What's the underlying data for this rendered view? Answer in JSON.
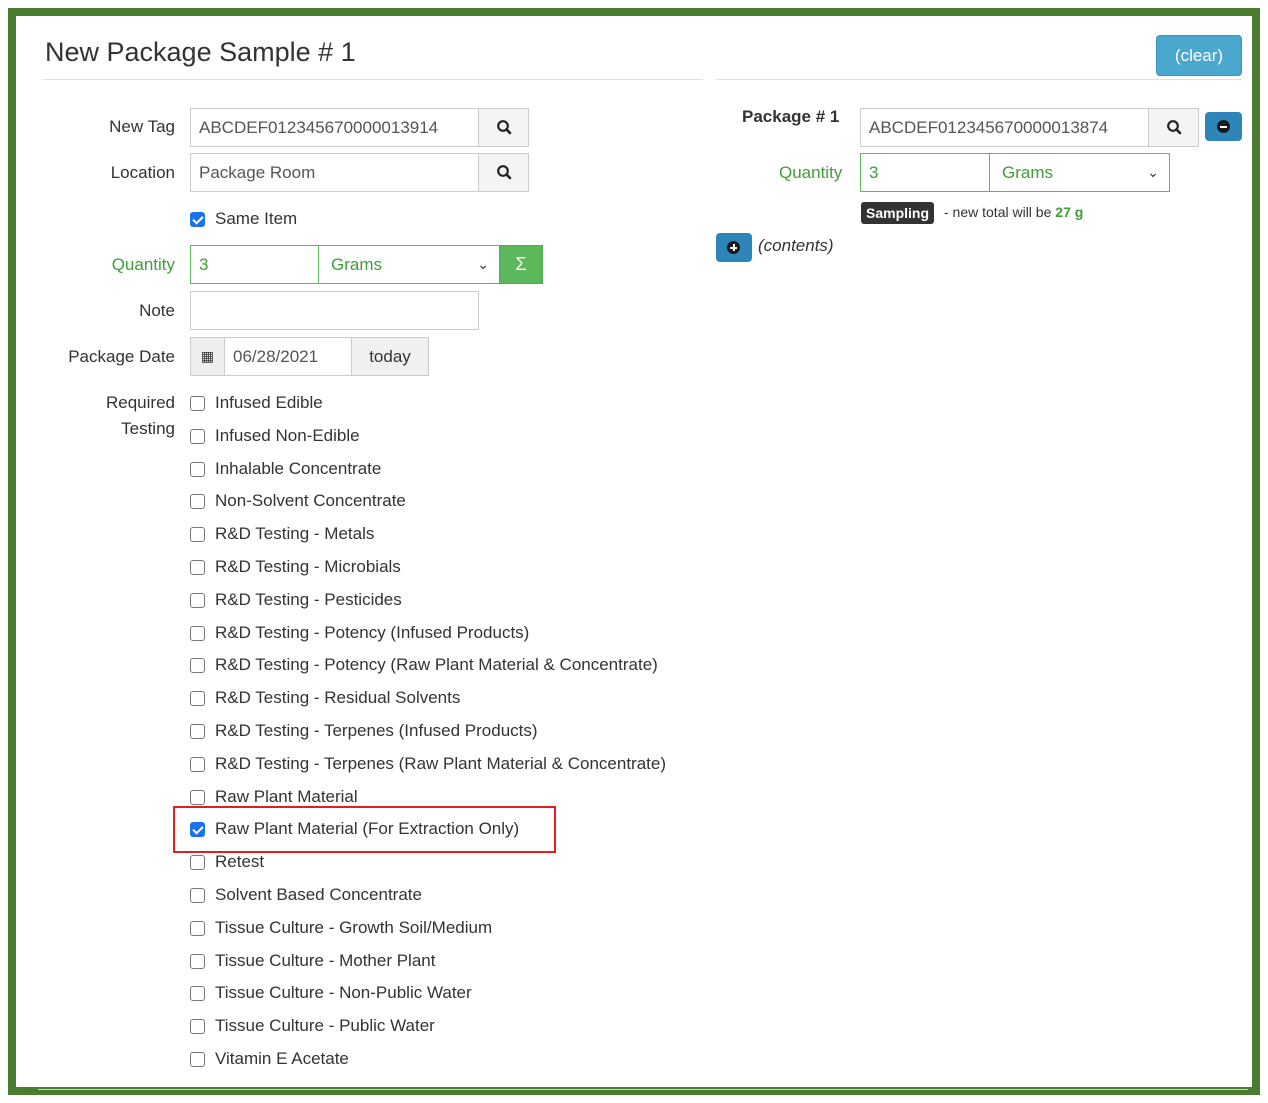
{
  "modal": {
    "title": "New Package Sample # 1",
    "clear_label": "(clear)"
  },
  "left": {
    "new_tag_label": "New Tag",
    "new_tag_value": "ABCDEF012345670000013914",
    "location_label": "Location",
    "location_value": "Package Room",
    "same_item_label": "Same Item",
    "same_item_checked": true,
    "quantity_label": "Quantity",
    "quantity_value": "3",
    "unit_value": "Grams",
    "sigma_label": "Σ",
    "note_label": "Note",
    "note_value": "",
    "package_date_label": "Package Date",
    "package_date_value": "06/28/2021",
    "today_label": "today",
    "required_testing_label_1": "Required",
    "required_testing_label_2": "Testing"
  },
  "tests": [
    {
      "label": "Infused Edible",
      "checked": false
    },
    {
      "label": "Infused Non-Edible",
      "checked": false
    },
    {
      "label": "Inhalable Concentrate",
      "checked": false
    },
    {
      "label": "Non-Solvent Concentrate",
      "checked": false
    },
    {
      "label": "R&D Testing - Metals",
      "checked": false
    },
    {
      "label": "R&D Testing - Microbials",
      "checked": false
    },
    {
      "label": "R&D Testing - Pesticides",
      "checked": false
    },
    {
      "label": "R&D Testing - Potency (Infused Products)",
      "checked": false
    },
    {
      "label": "R&D Testing - Potency (Raw Plant Material & Concentrate)",
      "checked": false
    },
    {
      "label": "R&D Testing - Residual Solvents",
      "checked": false
    },
    {
      "label": "R&D Testing - Terpenes (Infused Products)",
      "checked": false
    },
    {
      "label": "R&D Testing - Terpenes (Raw Plant Material & Concentrate)",
      "checked": false
    },
    {
      "label": "Raw Plant Material",
      "checked": false
    },
    {
      "label": "Raw Plant Material (For Extraction Only)",
      "checked": true
    },
    {
      "label": "Retest",
      "checked": false
    },
    {
      "label": "Solvent Based Concentrate",
      "checked": false
    },
    {
      "label": "Tissue Culture - Growth Soil/Medium",
      "checked": false
    },
    {
      "label": "Tissue Culture - Mother Plant",
      "checked": false
    },
    {
      "label": "Tissue Culture - Non-Public Water",
      "checked": false
    },
    {
      "label": "Tissue Culture - Public Water",
      "checked": false
    },
    {
      "label": "Vitamin E Acetate",
      "checked": false
    }
  ],
  "right": {
    "package_label": "Package # 1",
    "package_value": "ABCDEF012345670000013874",
    "quantity_label": "Quantity",
    "quantity_value": "3",
    "unit_value": "Grams",
    "badge_label": "Sampling",
    "total_text_prefix": "- new total will be",
    "total_value": "27 g",
    "contents_label": "(contents)"
  },
  "colors": {
    "frame": "#4a7d32",
    "accent_blue": "#4aa8cf",
    "green": "#3f9e38",
    "highlight": "#e02020"
  }
}
